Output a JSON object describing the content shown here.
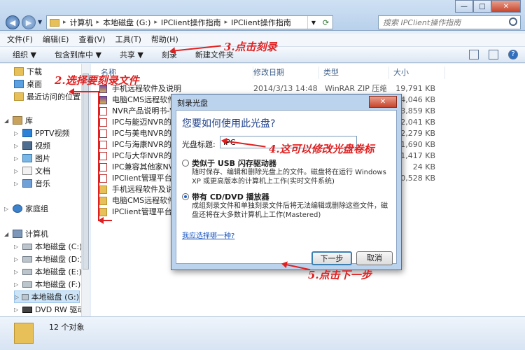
{
  "window": {
    "address": [
      "计算机",
      "本地磁盘 (G:)",
      "IPClient操作指南",
      "IPClient操作指南"
    ],
    "search_placeholder": "搜索 IPClient操作指南",
    "controls": [
      "—",
      "□",
      "✕"
    ]
  },
  "menubar": [
    "文件(F)",
    "编辑(E)",
    "查看(V)",
    "工具(T)",
    "帮助(H)"
  ],
  "commandbar": [
    "组织 ▼",
    "包含到库中 ▼",
    "共享 ▼",
    "刻录",
    "新建文件夹"
  ],
  "navpane": [
    {
      "label": "下载",
      "icon": "folder"
    },
    {
      "label": "桌面",
      "icon": "desk"
    },
    {
      "label": "最近访问的位置",
      "icon": "folder"
    },
    {
      "label": "库",
      "icon": "lib"
    },
    {
      "label": "PPTV视频",
      "icon": "pptv"
    },
    {
      "label": "视频",
      "icon": "video"
    },
    {
      "label": "图片",
      "icon": "pic"
    },
    {
      "label": "文档",
      "icon": "doc"
    },
    {
      "label": "音乐",
      "icon": "music"
    },
    {
      "label": "家庭组",
      "icon": "home"
    },
    {
      "label": "计算机",
      "icon": "pc"
    },
    {
      "label": "本地磁盘 (C:)",
      "icon": "disk"
    },
    {
      "label": "本地磁盘 (D:)",
      "icon": "disk"
    },
    {
      "label": "本地磁盘 (E:)",
      "icon": "disk"
    },
    {
      "label": "本地磁盘 (F:)",
      "icon": "disk"
    },
    {
      "label": "本地磁盘 (G:)",
      "icon": "disk"
    },
    {
      "label": "DVD RW 驱动",
      "icon": "dvd"
    }
  ],
  "columns": [
    "名称",
    "修改日期",
    "类型",
    "大小"
  ],
  "files": [
    {
      "name": "手机远程软件及说明",
      "date": "2014/3/13 14:48",
      "type": "WinRAR ZIP 压缩...",
      "size": "19,791 KB",
      "icon": "zip"
    },
    {
      "name": "电脑CMS远程软件",
      "date": "",
      "type": "",
      "size": "4,046 KB",
      "icon": "zip"
    },
    {
      "name": "NVR产品说明书-V",
      "date": "",
      "type": "",
      "size": "3,859 KB",
      "icon": "pdf"
    },
    {
      "name": "IPC与能迈NVR的",
      "date": "",
      "type": "",
      "size": "2,041 KB",
      "icon": "pdf"
    },
    {
      "name": "IPC与美电NVR的",
      "date": "",
      "type": "",
      "size": "2,279 KB",
      "icon": "pdf"
    },
    {
      "name": "IPC与海康NVR的",
      "date": "",
      "type": "",
      "size": "1,690 KB",
      "icon": "pdf"
    },
    {
      "name": "IPC与大华NVR的",
      "date": "",
      "type": "",
      "size": "1,417 KB",
      "icon": "pdf"
    },
    {
      "name": "IPC兼容其他家NV",
      "date": "",
      "type": "",
      "size": "24 KB",
      "icon": "pdf"
    },
    {
      "name": "IPClient管理平台",
      "date": "",
      "type": "",
      "size": "20,528 KB",
      "icon": "pdf"
    },
    {
      "name": "手机远程软件及说",
      "date": "",
      "type": "",
      "size": "",
      "icon": "folder"
    },
    {
      "name": "电脑CMS远程软件",
      "date": "",
      "type": "",
      "size": "",
      "icon": "folder"
    },
    {
      "name": "IPClient管理平台",
      "date": "",
      "type": "",
      "size": "",
      "icon": "folder"
    }
  ],
  "status": {
    "count": "12 个对象"
  },
  "dialog": {
    "title": "刻录光盘",
    "close": "✕",
    "heading": "您要如何使用此光盘?",
    "label": "光盘标题:",
    "input_value": "IPC",
    "option1": {
      "title": "类似于 USB 闪存驱动器",
      "desc": "随时保存、编辑和删除光盘上的文件。磁盘将在运行 Windows XP 或更高版本的计算机上工作(实时文件系统)"
    },
    "option2": {
      "title": "带有 CD/DVD 播放器",
      "desc": "成组刻录文件和单独刻录文件后将无法编辑或删除这些文件，磁盘还将在大多数计算机上工作(Mastered)"
    },
    "link": "我应选择哪一种?",
    "next": "下一步",
    "cancel": "取消"
  },
  "annotations": {
    "a1": "2.选择要刻录文件",
    "a3": "3.点击刻录",
    "a4": "4.这可以修改光盘卷标",
    "a5": "5.点击下一步"
  },
  "colors": {
    "annotation": "#e02020",
    "link": "#1a56c0",
    "heading": "#1e3f8a"
  }
}
